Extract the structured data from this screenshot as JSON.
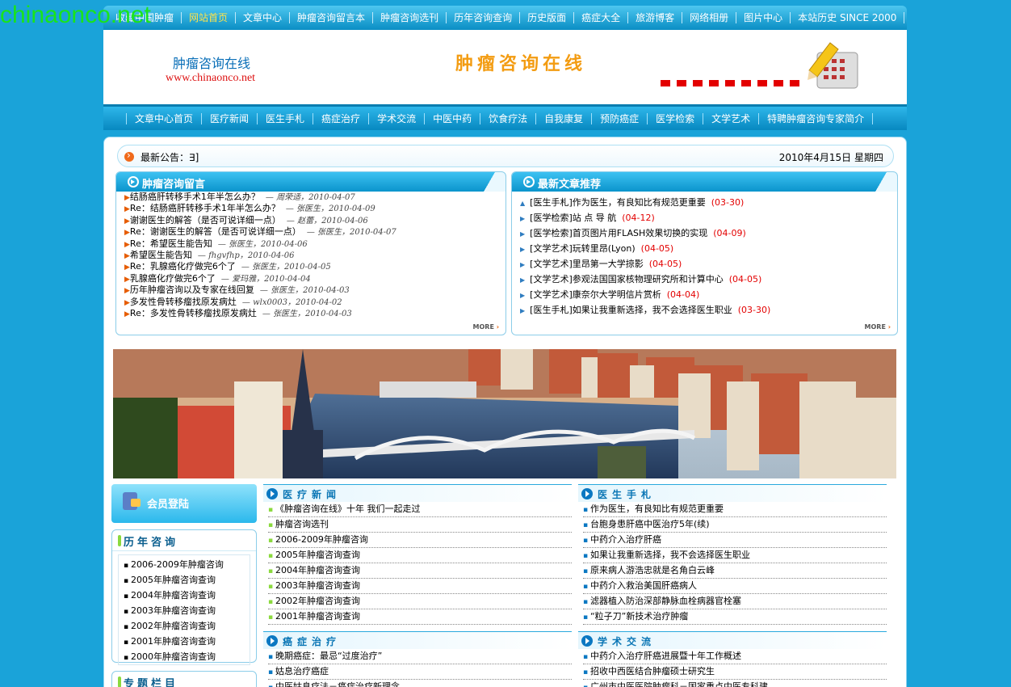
{
  "watermark": "chinaonco.net",
  "topnav": {
    "items": [
      {
        "label": "收藏中国肿瘤",
        "active": false
      },
      {
        "label": "网站首页",
        "active": true
      },
      {
        "label": "文章中心",
        "active": false
      },
      {
        "label": "肿瘤咨询留言本",
        "active": false
      },
      {
        "label": "肿瘤咨询选刊",
        "active": false
      },
      {
        "label": "历年咨询查询",
        "active": false
      },
      {
        "label": "历史版面",
        "active": false
      },
      {
        "label": "癌症大全",
        "active": false
      },
      {
        "label": "旅游博客",
        "active": false
      },
      {
        "label": "网络相册",
        "active": false
      },
      {
        "label": "图片中心",
        "active": false
      },
      {
        "label": "本站历史 SINCE 2000",
        "active": false
      }
    ]
  },
  "banner": {
    "logo_cn": "肿瘤咨询在线",
    "logo_en": "www.chinaonco.net",
    "slogan": "肿瘤咨询在线"
  },
  "mainnav": {
    "items": [
      "文章中心首页",
      "医疗新闻",
      "医生手札",
      "癌症治疗",
      "学术交流",
      "中医中药",
      "饮食疗法",
      "自我康复",
      "预防癌症",
      "医学检索",
      "文学艺术",
      "特聘肿瘤咨询专家简介"
    ]
  },
  "notice": {
    "label": "最新公告：∃]",
    "date": "2010年4月15日 星期四"
  },
  "guestbook": {
    "title": "肿瘤咨询留言",
    "more": "MORE",
    "items": [
      {
        "prefix": "",
        "text": "结肠癌肝转移手术1年半怎么办？",
        "meta": "— 周荣适，2010-04-07"
      },
      {
        "prefix": "Re：",
        "text": "结肠癌肝转移手术1年半怎么办？",
        "meta": "— 张医生，2010-04-09"
      },
      {
        "prefix": "",
        "text": "谢谢医生的解答（是否可说详细一点）",
        "meta": "— 赵蕾，2010-04-06"
      },
      {
        "prefix": "Re：",
        "text": "谢谢医生的解答（是否可说详细一点）",
        "meta": "— 张医生，2010-04-07"
      },
      {
        "prefix": "Re：",
        "text": "希望医生能告知",
        "meta": "— 张医生，2010-04-06"
      },
      {
        "prefix": "",
        "text": "希望医生能告知",
        "meta": "— fhgvfhp，2010-04-06"
      },
      {
        "prefix": "Re：",
        "text": "乳腺癌化疗做完6个了",
        "meta": "— 张医生，2010-04-05"
      },
      {
        "prefix": "",
        "text": "乳腺癌化疗做完6个了",
        "meta": "— 爱玛雅，2010-04-04"
      },
      {
        "prefix": "",
        "text": "历年肿瘤咨询以及专家在线回复",
        "meta": "— 张医生，2010-04-03"
      },
      {
        "prefix": "",
        "text": "多发性骨转移瘤找原发病灶",
        "meta": "— wlx0003，2010-04-02"
      },
      {
        "prefix": "Re：",
        "text": "多发性骨转移瘤找原发病灶",
        "meta": "— 张医生，2010-04-03"
      }
    ]
  },
  "latest": {
    "title": "最新文章推荐",
    "more": "MORE",
    "items": [
      {
        "text": "[医生手札]作为医生，有良知比有规范更重要",
        "date": "(03-30)"
      },
      {
        "text": "[医学检索]站 点 导 航",
        "date": "(04-12)"
      },
      {
        "text": "[医学检索]首页图片用FLASH效果切换的实现",
        "date": "(04-09)"
      },
      {
        "text": "[文学艺术]玩转里昂(Lyon)",
        "date": "(04-05)"
      },
      {
        "text": "[文学艺术]里昂第一大学掠影",
        "date": "(04-05)"
      },
      {
        "text": "[文学艺术]参观法国国家核物理研究所和计算中心",
        "date": "(04-05)"
      },
      {
        "text": "[文学艺术]康奈尔大学明信片赏析",
        "date": "(04-04)"
      },
      {
        "text": "[医生手札]如果让我重新选择，我不会选择医生职业",
        "date": "(03-30)"
      }
    ]
  },
  "member": {
    "label": "会员登陆"
  },
  "history": {
    "title": "历年咨询",
    "items": [
      "2006-2009年肿瘤咨询",
      "2005年肿瘤咨询查询",
      "2004年肿瘤咨询查询",
      "2003年肿瘤咨询查询",
      "2002年肿瘤咨询查询",
      "2001年肿瘤咨询查询",
      "2000年肿瘤咨询查询"
    ]
  },
  "topics": {
    "title": "专题栏目"
  },
  "news": {
    "title": "医疗新闻",
    "items": [
      "《肿瘤咨询在线》十年 我们一起走过",
      "肿瘤咨询选刊",
      "2006-2009年肿瘤咨询",
      "2005年肿瘤咨询查询",
      "2004年肿瘤咨询查询",
      "2003年肿瘤咨询查询",
      "2002年肿瘤咨询查询",
      "2001年肿瘤咨询查询"
    ]
  },
  "notes": {
    "title": "医生手札",
    "items": [
      "作为医生，有良知比有规范更重要",
      "台胞身患肝癌中医治疗5年(续)",
      "中药介入治疗肝癌",
      "如果让我重新选择，我不会选择医生职业",
      "原来病人游浩忠就是名角白云峰",
      "中药介入救治美国肝癌病人",
      "滤器植入防治深部静脉血栓病器官栓塞",
      "“粒子刀”新技术治疗肿瘤"
    ]
  },
  "treatment": {
    "title": "癌症治疗",
    "items": [
      "晚期癌症：最忌“过度治疗”",
      "姑息治疗癌症",
      "中医姑息疗法－癌症治疗新理念"
    ]
  },
  "academic": {
    "title": "学术交流",
    "items": [
      "中药介入治疗肝癌进展暨十年工作概述",
      "招收中西医结合肿瘤硕士研究生",
      "广州市中医医院肿瘤科－国家重点中医专科建"
    ]
  },
  "colors": {
    "accent": "#1aa3d9",
    "date_red": "#e30000",
    "nav_active": "#ffe34a"
  }
}
